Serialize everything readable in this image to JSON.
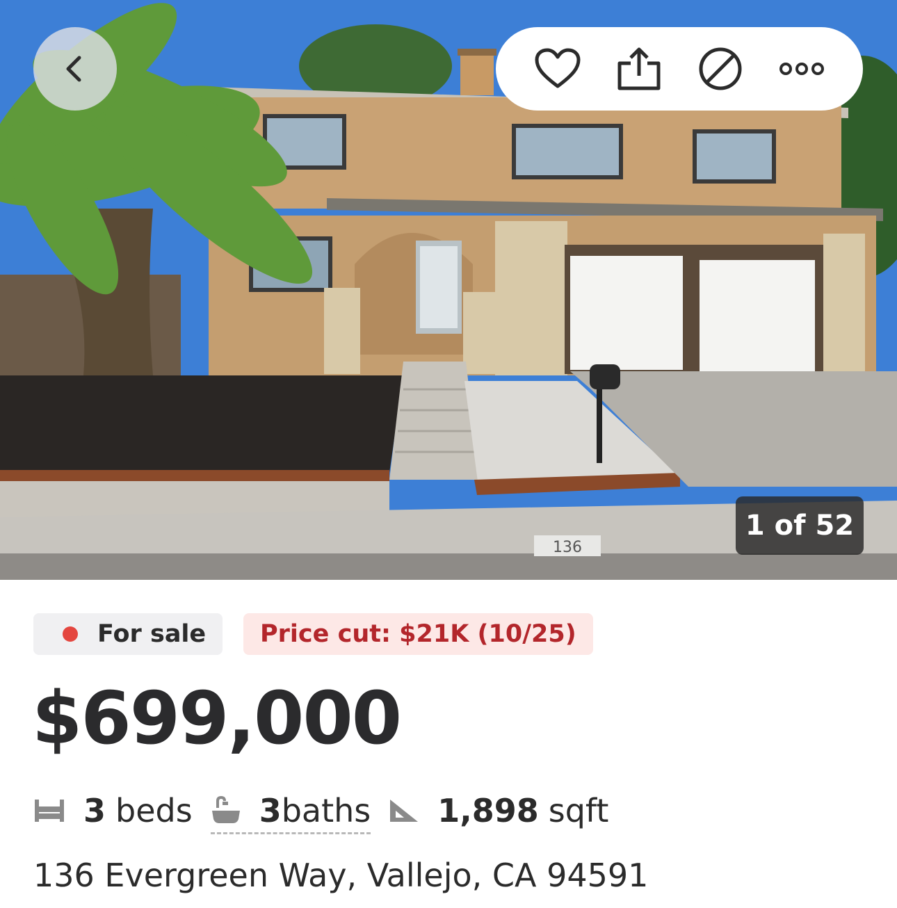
{
  "photo": {
    "alt": "House exterior photo",
    "counter": "1 of 52",
    "house_number_curb": "136"
  },
  "toolbar": {
    "back": "back",
    "favorite": "favorite",
    "share": "share",
    "hide": "hide",
    "more": "more"
  },
  "listing": {
    "status": "For sale",
    "status_color": "#e4463f",
    "price_cut": "Price cut: $21K (10/25)",
    "price": "$699,000",
    "beds_count": "3",
    "beds_label": "beds",
    "baths_count": "3",
    "baths_label": "baths",
    "sqft_count": "1,898",
    "sqft_label": "sqft",
    "address": "136 Evergreen Way, Vallejo, CA 94591"
  }
}
